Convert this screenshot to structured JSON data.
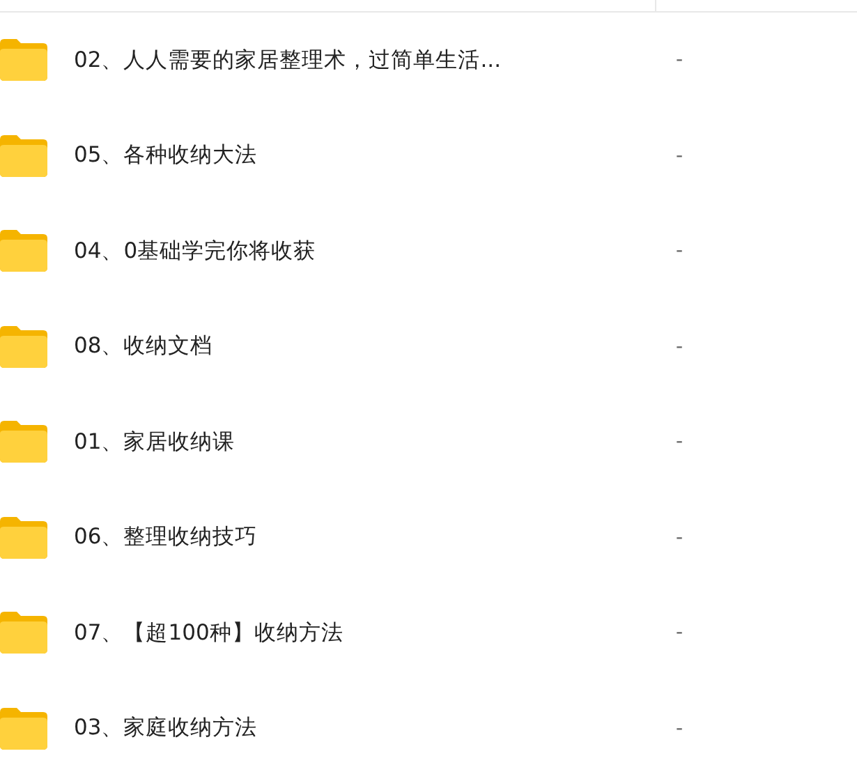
{
  "files": [
    {
      "name": "02、人人需要的家居整理术，过简单生活...",
      "size": "-"
    },
    {
      "name": "05、各种收纳大法",
      "size": "-"
    },
    {
      "name": "04、0基础学完你将收获",
      "size": "-"
    },
    {
      "name": "08、收纳文档",
      "size": "-"
    },
    {
      "name": "01、家居收纳课",
      "size": "-"
    },
    {
      "name": "06、整理收纳技巧",
      "size": "-"
    },
    {
      "name": "07、【超100种】收纳方法",
      "size": "-"
    },
    {
      "name": "03、家庭收纳方法",
      "size": "-"
    }
  ]
}
